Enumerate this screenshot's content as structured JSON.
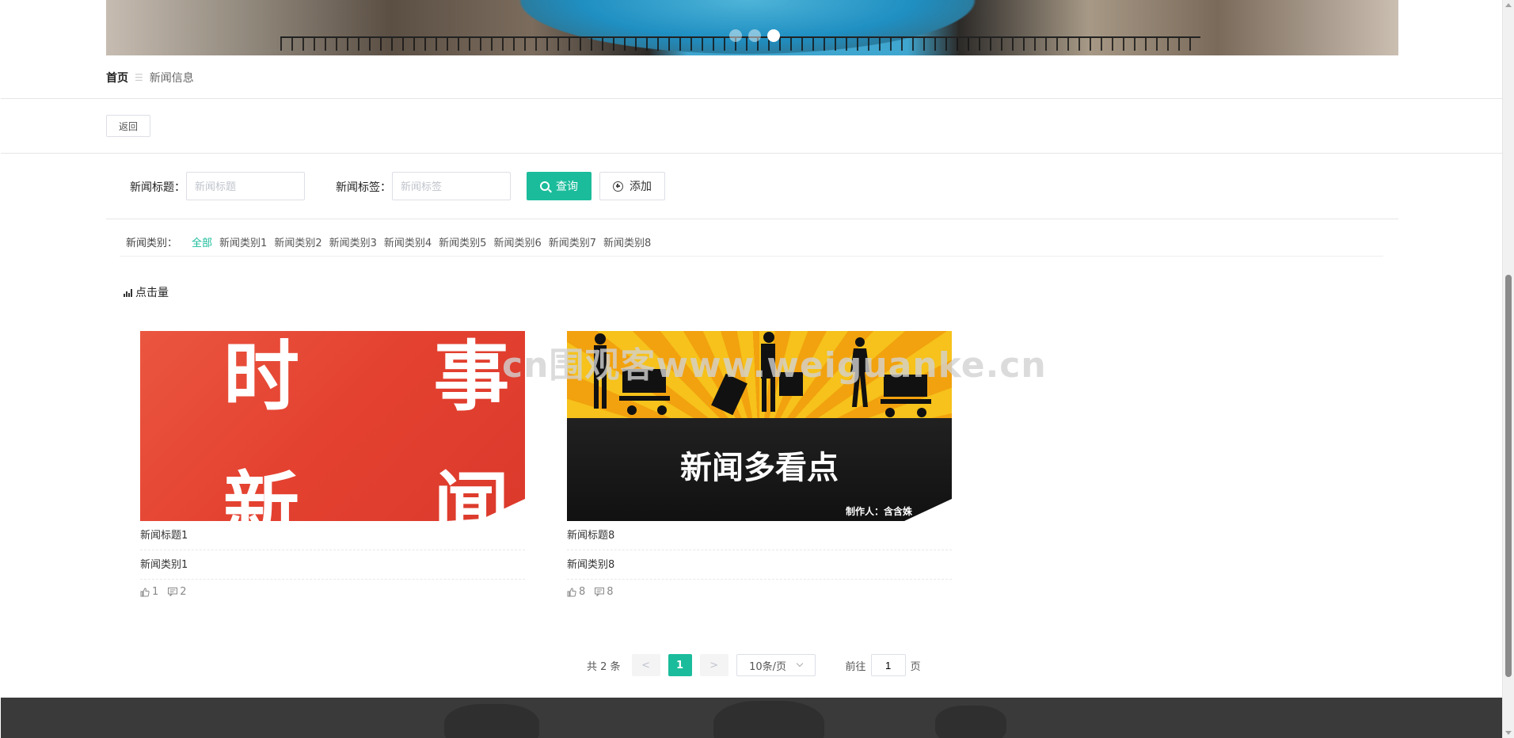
{
  "banner": {
    "slide_count": 3,
    "active_slide": 3
  },
  "breadcrumb": {
    "home": "首页",
    "separator": "☰",
    "current": "新闻信息"
  },
  "back_button": "返回",
  "search": {
    "title_label": "新闻标题：",
    "title_placeholder": "新闻标题",
    "tag_label": "新闻标签：",
    "tag_placeholder": "新闻标签",
    "query_button": "查询",
    "add_button": "添加"
  },
  "categories": {
    "label": "新闻类别：",
    "items": [
      "全部",
      "新闻类别1",
      "新闻类别2",
      "新闻类别3",
      "新闻类别4",
      "新闻类别5",
      "新闻类别6",
      "新闻类别7",
      "新闻类别8"
    ],
    "active": "全部"
  },
  "sort": {
    "label": "点击量"
  },
  "cards": [
    {
      "image_text": [
        "时 事",
        "新 闻"
      ],
      "title": "新闻标题1",
      "category": "新闻类别1",
      "likes": "1",
      "comments": "2"
    },
    {
      "image_text": [
        "新闻多看点",
        "制作人：含含姝"
      ],
      "title": "新闻标题8",
      "category": "新闻类别8",
      "likes": "8",
      "comments": "8"
    }
  ],
  "watermark": "cn围观客www.weiguanke.cn",
  "pagination": {
    "total": "共 2 条",
    "prev": "<",
    "current_page": "1",
    "next": ">",
    "page_size": "10条/页",
    "goto_label": "前往",
    "goto_value": "1",
    "page_suffix": "页"
  },
  "colors": {
    "accent": "#1bbc9b",
    "footer": "#3a3a3a"
  }
}
